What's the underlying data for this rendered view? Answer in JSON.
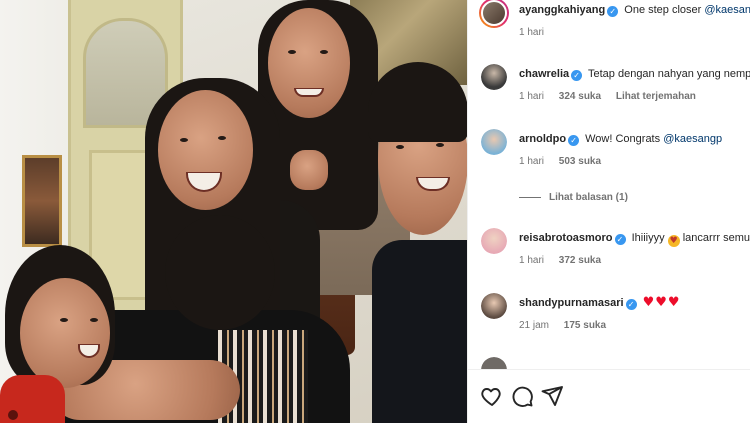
{
  "post": {
    "caption": {
      "username": "ayanggkahiyang",
      "text": "One step closer",
      "mention": "@kaesangp",
      "time": "1 hari"
    },
    "comments": [
      {
        "username": "chawrelia",
        "text": "Tetap dengan nahyan yang nemplok",
        "time": "1 hari",
        "likes": "324 suka",
        "action": "Lihat terjemahan"
      },
      {
        "username": "arnoldpo",
        "text": "Wow! Congrats",
        "mention": "@kaesangp",
        "time": "1 hari",
        "likes": "503 suka"
      },
      {
        "username": "reisabrotoasmoro",
        "text": "Ihiiiyyy",
        "text_after": "lancarrr semuang",
        "time": "1 hari",
        "likes": "372 suka"
      },
      {
        "username": "shandypurnamasari",
        "text": "♥♥♥",
        "time": "21 jam",
        "likes": "175 suka"
      }
    ],
    "view_replies": "Lihat balasan (1)",
    "actions": [
      "heart-icon",
      "comment-icon",
      "share-icon"
    ]
  },
  "colors": {
    "verified": "#3897f0",
    "mention": "#00376b",
    "muted": "#737373",
    "heart": "#ed0d2b"
  }
}
